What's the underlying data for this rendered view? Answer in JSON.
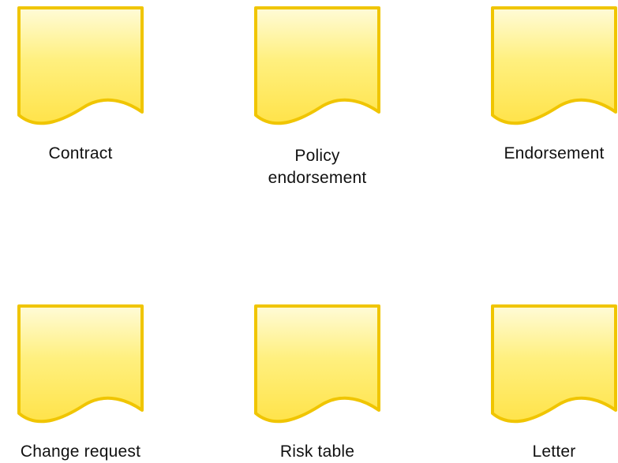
{
  "diagram": {
    "shapes": [
      {
        "label": "Contract"
      },
      {
        "label": "Policy\nendorsement"
      },
      {
        "label": "Endorsement"
      },
      {
        "label": "Change request"
      },
      {
        "label": "Risk table"
      },
      {
        "label": "Letter"
      }
    ]
  },
  "colors": {
    "fill_top": "#fffbd8",
    "fill_bottom": "#ffe34a",
    "stroke": "#f0c500"
  }
}
